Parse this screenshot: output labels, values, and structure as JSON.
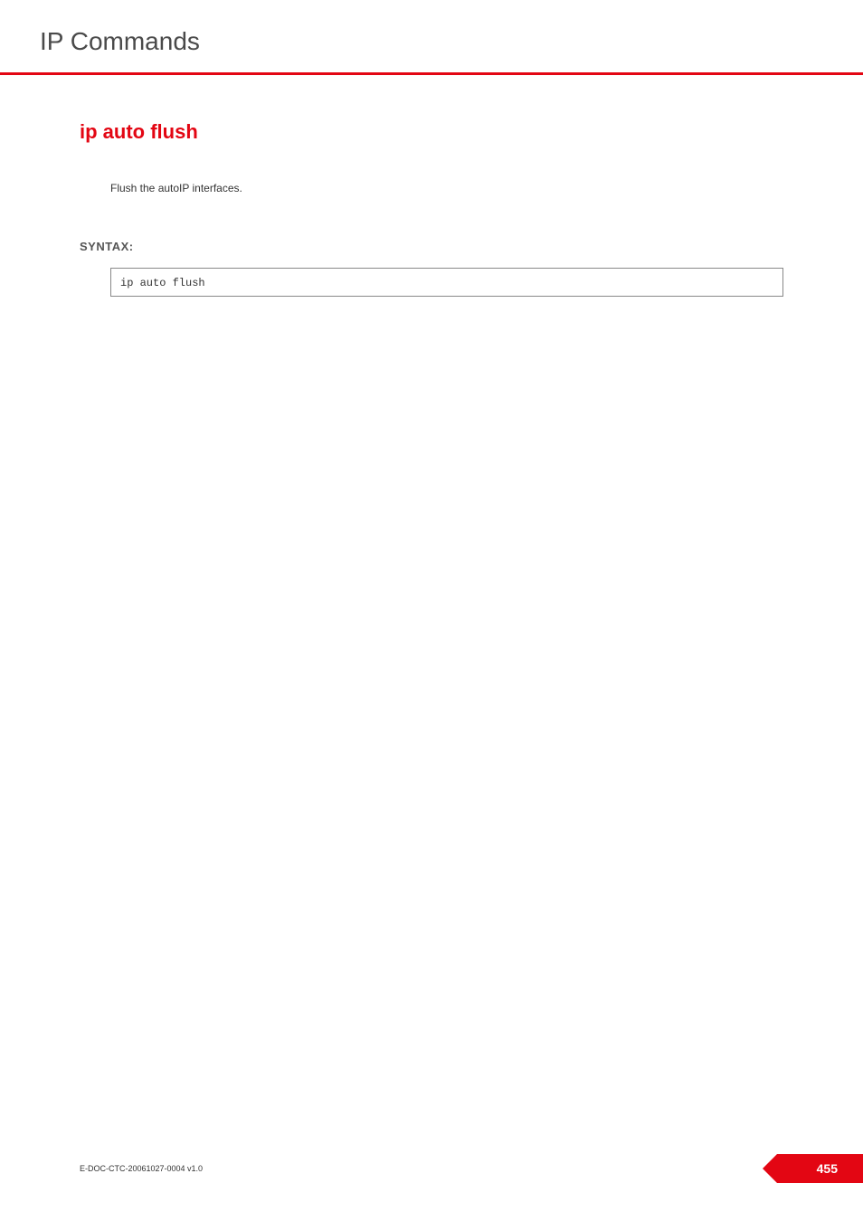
{
  "header": {
    "title": "IP Commands"
  },
  "content": {
    "command_title": "ip auto flush",
    "description": "Flush the autoIP interfaces.",
    "syntax_label": "SYNTAX:",
    "code": "ip auto flush"
  },
  "footer": {
    "doc_id": "E-DOC-CTC-20061027-0004 v1.0",
    "page_number": "455"
  }
}
